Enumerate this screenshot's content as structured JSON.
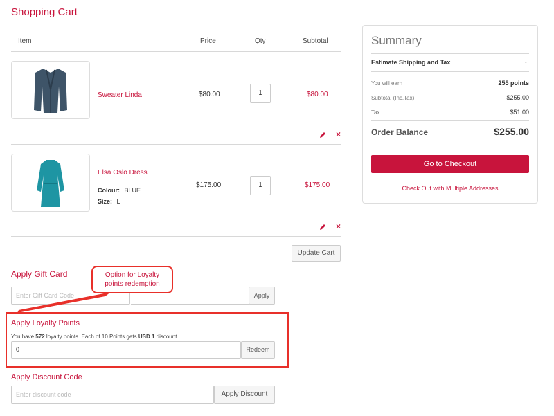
{
  "page": {
    "title": "Shopping Cart"
  },
  "table": {
    "headers": {
      "item": "Item",
      "price": "Price",
      "qty": "Qty",
      "subtotal": "Subtotal"
    }
  },
  "items": [
    {
      "name": "Sweater Linda",
      "price": "$80.00",
      "qty": "1",
      "subtotal": "$80.00",
      "image": "sweater"
    },
    {
      "name": "Elsa Oslo Dress",
      "options": [
        {
          "label": "Colour:",
          "value": "BLUE"
        },
        {
          "label": "Size:",
          "value": "L"
        }
      ],
      "price": "$175.00",
      "qty": "1",
      "subtotal": "$175.00",
      "image": "dress"
    }
  ],
  "actions": {
    "update_cart": "Update Cart"
  },
  "gift_card": {
    "title": "Apply Gift Card",
    "placeholder": "Enter Gift Card Code",
    "apply": "Apply"
  },
  "callout": {
    "line1": "Option for Loyalty",
    "line2": "points redemption"
  },
  "loyalty": {
    "title": "Apply Loyalty Points",
    "text_pre": "You have ",
    "points": "572",
    "text_mid": " loyalty points. Each of 10 Points gets ",
    "currency_amount": "USD 1",
    "text_post": " discount.",
    "value": "0",
    "button": "Redeem"
  },
  "discount": {
    "title": "Apply Discount Code",
    "placeholder": "Enter discount code",
    "button": "Apply Discount"
  },
  "summary": {
    "title": "Summary",
    "estimate": "Estimate Shipping and Tax",
    "earn_label": "You will earn",
    "earn_value": "255 points",
    "subtotal_label": "Subtotal (Inc.Tax)",
    "subtotal_value": "$255.00",
    "tax_label": "Tax",
    "tax_value": "$51.00",
    "balance_label": "Order Balance",
    "balance_value": "$255.00",
    "checkout": "Go to Checkout",
    "multi": "Check Out with Multiple Addresses"
  },
  "colors": {
    "accent": "#c8143c",
    "annotation": "#e8302a"
  }
}
